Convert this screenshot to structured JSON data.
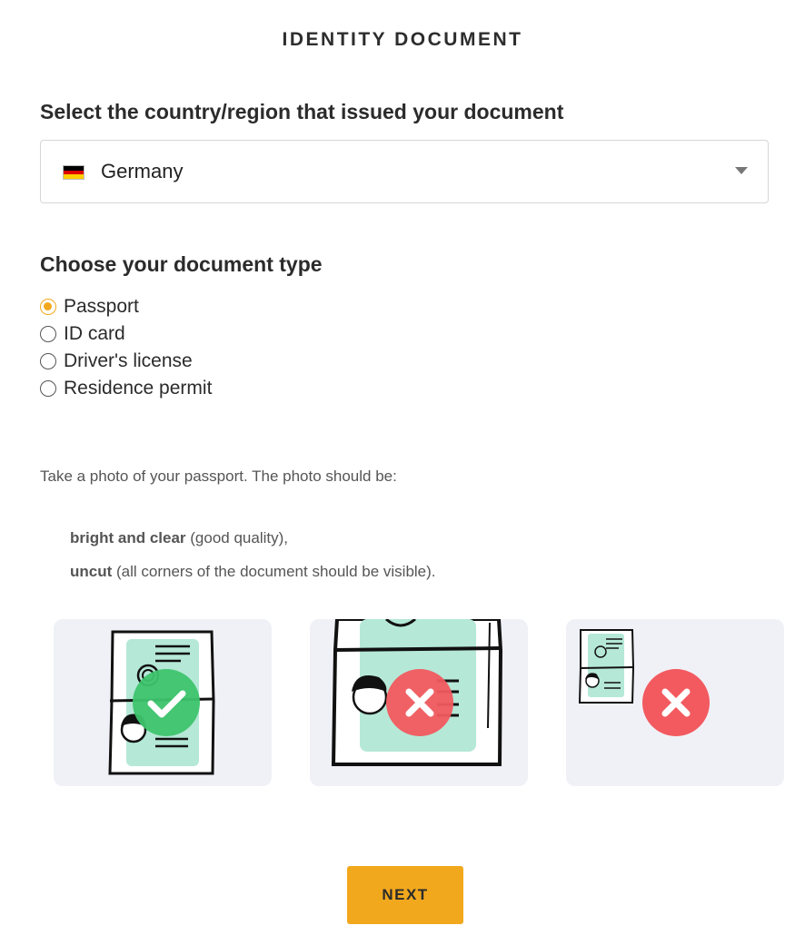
{
  "header": {
    "title": "IDENTITY DOCUMENT"
  },
  "country": {
    "heading": "Select the country/region that issued your document",
    "selected": "Germany",
    "flag_colors": [
      "#000000",
      "#dd0000",
      "#ffce00"
    ]
  },
  "doc_type": {
    "heading": "Choose your document type",
    "options": [
      {
        "label": "Passport",
        "checked": true
      },
      {
        "label": "ID card",
        "checked": false
      },
      {
        "label": "Driver's license",
        "checked": false
      },
      {
        "label": "Residence permit",
        "checked": false
      }
    ]
  },
  "instructions": {
    "intro": "Take a photo of your passport. The photo should be:",
    "req1_bold": "bright and clear",
    "req1_rest": " (good quality),",
    "req2_bold": "uncut",
    "req2_rest": " (all corners of the document should be visible)."
  },
  "examples": [
    {
      "icon": "check-icon",
      "status": "good"
    },
    {
      "icon": "cross-icon",
      "status": "cropped"
    },
    {
      "icon": "cross-icon",
      "status": "too-small"
    }
  ],
  "actions": {
    "next_label": "NEXT"
  },
  "colors": {
    "accent": "#f2a81d",
    "good": "#3ec46d",
    "bad": "#f25a5f",
    "doc_fill": "#b5e8d7",
    "card_bg": "#f0f1f7"
  }
}
